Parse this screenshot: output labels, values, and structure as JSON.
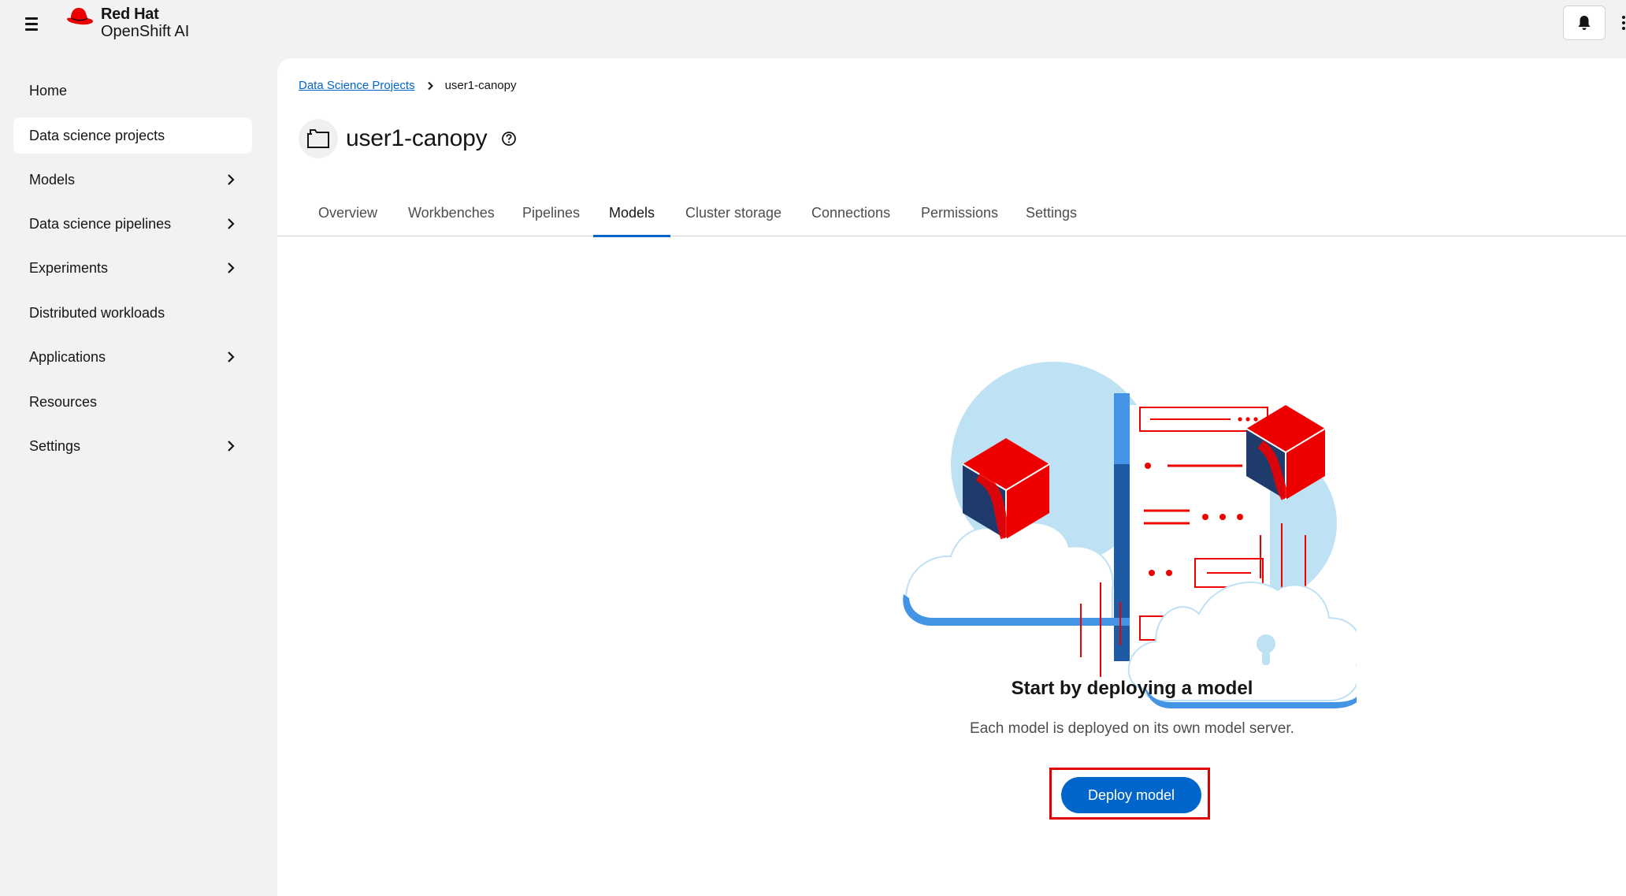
{
  "masthead": {
    "brand_line1": "Red Hat",
    "brand_line2": "OpenShift AI"
  },
  "sidebar": {
    "items": [
      {
        "label": "Home",
        "expandable": false,
        "active": false
      },
      {
        "label": "Data science projects",
        "expandable": false,
        "active": true
      },
      {
        "label": "Models",
        "expandable": true,
        "active": false
      },
      {
        "label": "Data science pipelines",
        "expandable": true,
        "active": false
      },
      {
        "label": "Experiments",
        "expandable": true,
        "active": false
      },
      {
        "label": "Distributed workloads",
        "expandable": false,
        "active": false
      },
      {
        "label": "Applications",
        "expandable": true,
        "active": false
      },
      {
        "label": "Resources",
        "expandable": false,
        "active": false
      },
      {
        "label": "Settings",
        "expandable": true,
        "active": false
      }
    ]
  },
  "breadcrumb": {
    "parent": "Data Science Projects",
    "current": "user1-canopy"
  },
  "project": {
    "title": "user1-canopy"
  },
  "tabs": [
    {
      "label": "Overview",
      "active": false
    },
    {
      "label": "Workbenches",
      "active": false
    },
    {
      "label": "Pipelines",
      "active": false
    },
    {
      "label": "Models",
      "active": true
    },
    {
      "label": "Cluster storage",
      "active": false
    },
    {
      "label": "Connections",
      "active": false
    },
    {
      "label": "Permissions",
      "active": false
    },
    {
      "label": "Settings",
      "active": false
    }
  ],
  "empty_state": {
    "title": "Start by deploying a model",
    "body": "Each model is deployed on its own model server.",
    "button_label": "Deploy model"
  },
  "colors": {
    "accent": "#0066cc",
    "brand_red": "#ee0000",
    "highlight_border": "#e00000"
  }
}
